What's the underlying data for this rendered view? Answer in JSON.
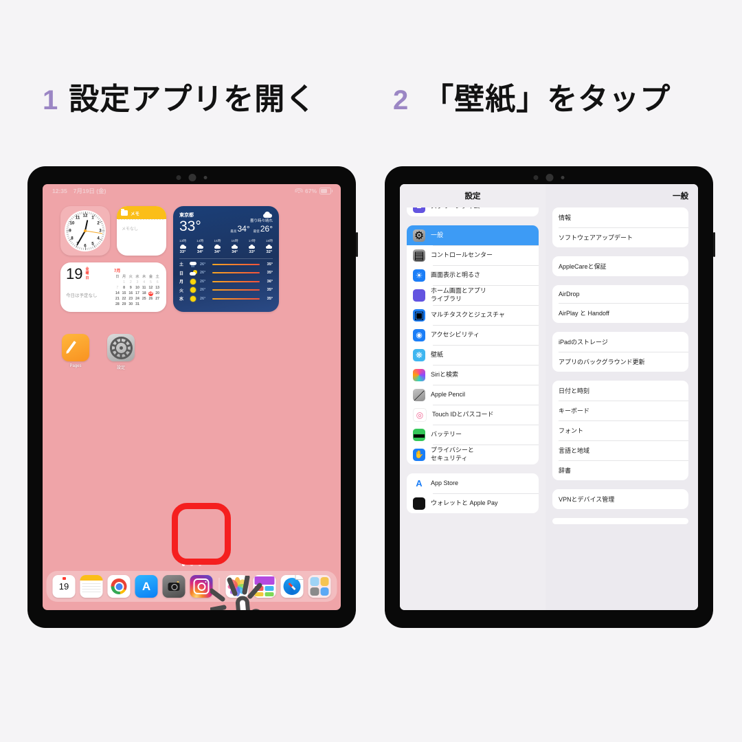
{
  "steps": [
    {
      "number": "1",
      "text": "設定アプリを開く"
    },
    {
      "number": "2",
      "text": "「壁紙」をタップ"
    }
  ],
  "accent_purple": "#9b86c4",
  "highlight_red": "#f51f1f",
  "home_screen": {
    "status_bar": {
      "time": "12:35",
      "date": "7月19日 (金)",
      "battery_percent": "67%",
      "wifi_icon": "wifi-icon",
      "battery_icon": "battery-icon"
    },
    "clock_widget": {
      "numbers": [
        "12",
        "1",
        "2",
        "3",
        "4",
        "5",
        "6",
        "7",
        "8",
        "9",
        "10",
        "11"
      ]
    },
    "notes_widget": {
      "title": "メモ",
      "body": "メモなし",
      "icon": "folder-icon"
    },
    "calendar_widget": {
      "day": "19",
      "weekday": "金曜日",
      "note": "今日は予定なし",
      "month": "7月",
      "weekday_headers": [
        "日",
        "月",
        "火",
        "水",
        "木",
        "金",
        "土"
      ],
      "weeks": [
        [
          "",
          "1",
          "2",
          "3",
          "4",
          "5",
          "6"
        ],
        [
          "7",
          "8",
          "9",
          "10",
          "11",
          "12",
          "13"
        ],
        [
          "14",
          "15",
          "16",
          "17",
          "18",
          "19",
          "20"
        ],
        [
          "21",
          "22",
          "23",
          "24",
          "25",
          "26",
          "27"
        ],
        [
          "28",
          "29",
          "30",
          "31",
          "",
          "",
          ""
        ]
      ],
      "today": "19"
    },
    "weather_widget": {
      "city": "東京都",
      "current_temp": "33°",
      "condition": "曇り時々晴れ",
      "high_label": "最高",
      "high": "34°",
      "low_label": "最低",
      "low": "26°",
      "hourly": [
        {
          "hour": "13時",
          "icon": "cloud-icon",
          "temp": "33°"
        },
        {
          "hour": "14時",
          "icon": "cloud-icon",
          "temp": "34°"
        },
        {
          "hour": "15時",
          "icon": "cloud-icon",
          "temp": "34°"
        },
        {
          "hour": "16時",
          "icon": "cloud-icon",
          "temp": "34°"
        },
        {
          "hour": "17時",
          "icon": "cloud-icon",
          "temp": "33°"
        },
        {
          "hour": "18時",
          "icon": "cloud-icon",
          "temp": "32°"
        }
      ],
      "daily": [
        {
          "day": "土",
          "icon": "rain-icon",
          "low": "26°",
          "high": "35°"
        },
        {
          "day": "日",
          "icon": "partly-cloudy-icon",
          "low": "26°",
          "high": "35°"
        },
        {
          "day": "月",
          "icon": "sun-icon",
          "low": "26°",
          "high": "36°"
        },
        {
          "day": "火",
          "icon": "sun-icon",
          "low": "26°",
          "high": "35°"
        },
        {
          "day": "水",
          "icon": "sun-icon",
          "low": "26°",
          "high": "35°"
        }
      ]
    },
    "apps": [
      {
        "label": "Pages",
        "icon": "pages-icon"
      },
      {
        "label": "設定",
        "icon": "settings-gear-icon"
      }
    ],
    "dock": [
      {
        "name": "calendar-icon",
        "label": "19"
      },
      {
        "name": "notes-icon",
        "label": ""
      },
      {
        "name": "chrome-icon",
        "label": ""
      },
      {
        "name": "app-store-icon",
        "label": ""
      },
      {
        "name": "camera-icon",
        "label": ""
      },
      {
        "name": "instagram-icon",
        "label": ""
      },
      {
        "name": "photos-icon",
        "label": ""
      },
      {
        "name": "keynote-icon",
        "label": ""
      },
      {
        "name": "safari-icon",
        "label": ""
      },
      {
        "name": "app-library-icon",
        "label": ""
      }
    ],
    "page_dots": 3,
    "active_page_dot": 1,
    "cursor": "pointing-hand-tap-cursor"
  },
  "settings_screen": {
    "sidebar_title": "設定",
    "detail_title": "一般",
    "sidebar_groups": [
      {
        "items": [
          {
            "label": "スクリーンタイム",
            "icon": "screen-time-icon",
            "selected": false
          }
        ]
      },
      {
        "items": [
          {
            "label": "一般",
            "icon": "general-gear-icon",
            "selected": true
          },
          {
            "label": "コントロールセンター",
            "icon": "control-center-icon",
            "selected": false
          },
          {
            "label": "画面表示と明るさ",
            "icon": "display-brightness-icon",
            "selected": false
          },
          {
            "label": "ホーム画面とアプリ",
            "label2": "ライブラリ",
            "icon": "home-screen-icon",
            "selected": false
          },
          {
            "label": "マルチタスクとジェスチャ",
            "icon": "multitasking-icon",
            "selected": false
          },
          {
            "label": "アクセシビリティ",
            "icon": "accessibility-icon",
            "selected": false
          },
          {
            "label": "壁紙",
            "icon": "wallpaper-icon",
            "selected": false,
            "highlighted": true
          },
          {
            "label": "Siriと検索",
            "icon": "siri-icon",
            "selected": false
          },
          {
            "label": "Apple Pencil",
            "icon": "apple-pencil-icon",
            "selected": false
          },
          {
            "label": "Touch IDとパスコード",
            "icon": "touch-id-icon",
            "selected": false
          },
          {
            "label": "バッテリー",
            "icon": "battery-icon",
            "selected": false
          },
          {
            "label": "プライバシーと",
            "label2": "セキュリティ",
            "icon": "privacy-icon",
            "selected": false
          }
        ]
      },
      {
        "items": [
          {
            "label": "App Store",
            "icon": "app-store-icon",
            "selected": false
          },
          {
            "label": "ウォレットと Apple Pay",
            "icon": "wallet-icon",
            "selected": false
          }
        ]
      }
    ],
    "detail_groups": [
      {
        "rows": [
          "情報",
          "ソフトウェアアップデート"
        ]
      },
      {
        "rows": [
          "AppleCareと保証"
        ]
      },
      {
        "rows": [
          "AirDrop",
          "AirPlay と Handoff"
        ]
      },
      {
        "rows": [
          "iPadのストレージ",
          "アプリのバックグラウンド更新"
        ]
      },
      {
        "rows": [
          "日付と時刻",
          "キーボード",
          "フォント",
          "言語と地域",
          "辞書"
        ]
      },
      {
        "rows": [
          "VPNとデバイス管理"
        ]
      }
    ]
  }
}
